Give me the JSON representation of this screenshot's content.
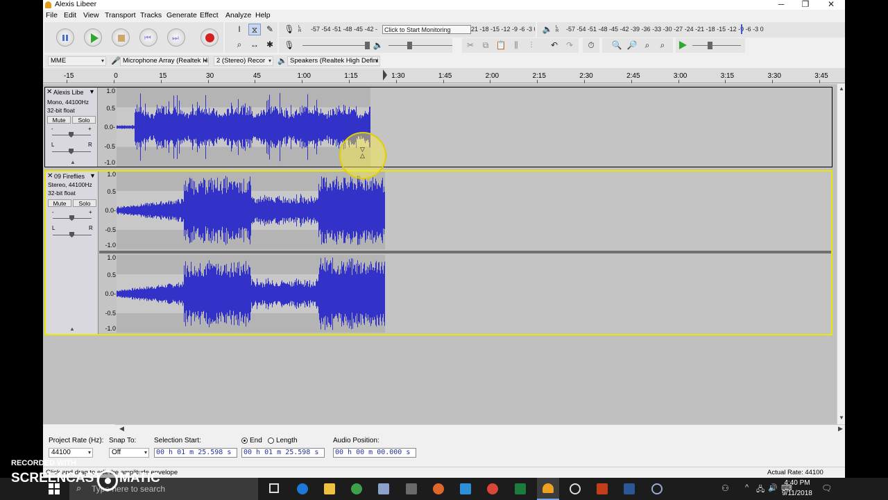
{
  "window": {
    "title": "Alexis Libeer",
    "controls": {
      "minimize": "─",
      "maximize": "❐",
      "close": "✕"
    }
  },
  "menu": [
    "File",
    "Edit",
    "View",
    "Transport",
    "Tracks",
    "Generate",
    "Effect",
    "Analyze",
    "Help"
  ],
  "meters": {
    "record_scale": "-57 -54 -51 -48 -45 -42 -",
    "record_hint": "Click to Start Monitoring",
    "record_scale_tail": "21 -18 -15 -12  -9  -6  -3  0",
    "playback_scale": "-57 -54 -51 -48 -45 -42 -39 -36 -33 -30 -27 -24 -21 -18 -15 -12  -9  -6  -3  0",
    "record_lr": "L\nR",
    "playback_lr": "L\nR"
  },
  "devices": {
    "host": "MME",
    "mic": "Microphone Array (Realtek Hi",
    "channels": "2 (Stereo) Recor",
    "speakers": "Speakers (Realtek High Defini"
  },
  "ruler": {
    "labels": [
      "-15",
      "0",
      "15",
      "30",
      "45",
      "1:00",
      "1:15",
      "1:30",
      "1:45",
      "2:00",
      "2:15",
      "2:30",
      "2:45",
      "3:00",
      "3:15",
      "3:30",
      "3:45"
    ],
    "seconds": [
      -15,
      0,
      15,
      30,
      45,
      60,
      75,
      90,
      105,
      120,
      135,
      150,
      165,
      180,
      195,
      210,
      225
    ]
  },
  "tracks": [
    {
      "name": "Alexis Libe",
      "info": [
        "Mono, 44100Hz",
        "32-bit float"
      ],
      "mute": "Mute",
      "solo": "Solo",
      "pan_l": "L",
      "pan_r": "R",
      "gain_minus": "-",
      "gain_plus": "+",
      "scale": [
        "1.0",
        "0.5",
        "0.0-",
        "-0.5",
        "-1.0"
      ],
      "channels": 1,
      "duration_seconds": 81
    },
    {
      "name": "09 Fireflies",
      "info": [
        "Stereo, 44100Hz",
        "32-bit float"
      ],
      "mute": "Mute",
      "solo": "Solo",
      "pan_l": "L",
      "pan_r": "R",
      "gain_minus": "-",
      "gain_plus": "+",
      "scale": [
        "1.0",
        "0.5",
        "0.0-",
        "-0.5",
        "-1.0"
      ],
      "scale2": [
        "1.0",
        "0.5",
        "0.0-",
        "-0.5",
        "-1.0"
      ],
      "channels": 2,
      "duration_seconds": 85.6
    }
  ],
  "selection": {
    "project_rate_label": "Project Rate (Hz):",
    "project_rate": "44100",
    "snap_label": "Snap To:",
    "snap": "Off",
    "start_label": "Selection Start:",
    "end_label": "End",
    "length_label": "Length",
    "start": "00 h 01 m 25.598 s",
    "end": "00 h 01 m 25.598 s",
    "audio_pos_label": "Audio Position:",
    "audio_pos": "00 h 00 m 00.000 s"
  },
  "status": {
    "hint": "Click and drag to edit the amplitude envelope",
    "actual_rate": "Actual Rate: 44100"
  },
  "watermark": {
    "line1": "RECORDED WITH",
    "line2a": "SCREENCAST",
    "line2b": "MATIC"
  },
  "taskbar": {
    "search_placeholder": "Type here to search",
    "time": "4:40 PM",
    "date": "9/11/2018"
  },
  "colors": {
    "wave": "#3232c8",
    "track_bg": "#c4c4c4",
    "clip_bg": "#b4b4b4",
    "selected_border": "#e8e800"
  }
}
